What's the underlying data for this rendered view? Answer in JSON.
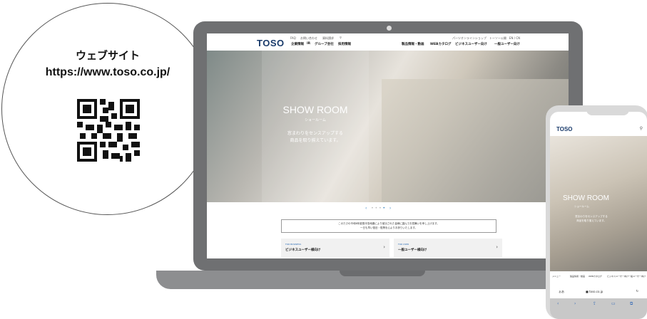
{
  "callout": {
    "title": "ウェブサイト",
    "url": "https://www.toso.co.jp/",
    "qr_icon": "qr-code-icon"
  },
  "site": {
    "logo": "TOSO",
    "top_links": [
      "FAQ",
      "お問い合わせ",
      "資料請求"
    ],
    "top_right_links": "パーツオンラインショップ　トーソー公開　EN / CN",
    "nav_left": [
      "企業情報",
      "IR",
      "グループ会社",
      "採用情報"
    ],
    "nav_right": [
      "製品情報・動画",
      "WEBカタログ",
      "ビジネスユーザー向け",
      "一般ユーザー向け"
    ],
    "hero_title": "SHOW ROOM",
    "hero_subtitle": "ショールーム",
    "hero_line1": "窓まわりをセンスアップする",
    "hero_line2": "商品を取り揃えています。",
    "notice_line1": "このたびの令和6年能登半島地震により被災された皆様に謹んでお見舞いを申し上げます。",
    "notice_line2": "一日も早い復旧・復興を心よりお祈りいたします。",
    "card_business_label": "FOR BUSINESS",
    "card_business_title": "ビジネスユーザー様向け",
    "card_user_label": "FOR USER",
    "card_user_title": "一般ユーザー様向け"
  },
  "phone": {
    "logo": "TOSO",
    "hero_title": "SHOW ROOM",
    "hero_subtitle": "ショールーム",
    "hero_line1": "窓まわりをセンスアップする",
    "hero_line2": "商品を取り揃えています。",
    "nav": [
      "メニュー",
      "製品情報・動画",
      "WEBカタログ",
      "ビジネスユーザー向け",
      "一般ユーザー向け"
    ],
    "url_left": "ぁあ",
    "url": "■ toso.co.jp"
  }
}
